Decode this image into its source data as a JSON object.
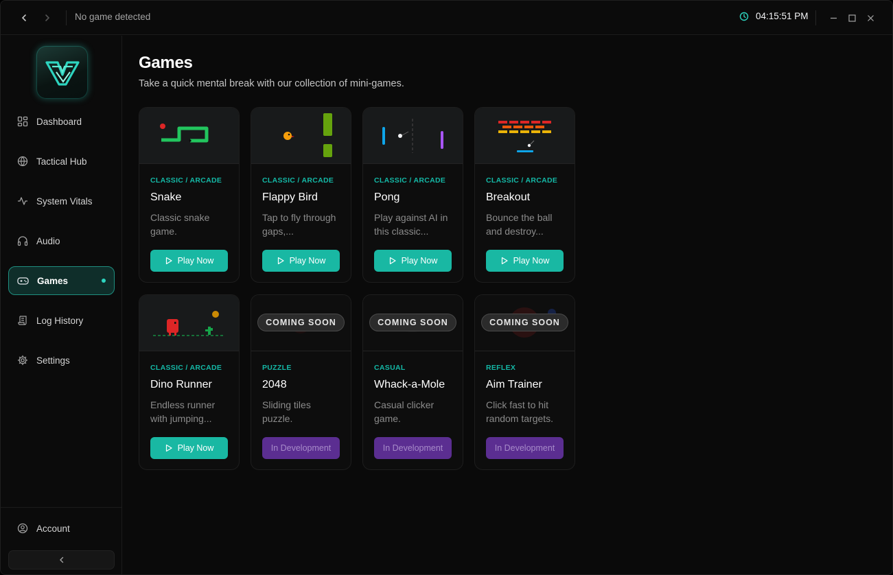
{
  "titlebar": {
    "status": "No game detected",
    "time": "04:15:51 PM"
  },
  "sidebar": {
    "items": [
      {
        "label": "Dashboard"
      },
      {
        "label": "Tactical Hub"
      },
      {
        "label": "System Vitals"
      },
      {
        "label": "Audio"
      },
      {
        "label": "Games"
      },
      {
        "label": "Log History"
      },
      {
        "label": "Settings"
      }
    ],
    "account": "Account",
    "active": "Games"
  },
  "main": {
    "title": "Games",
    "subtitle": "Take a quick mental break with our collection of mini-games."
  },
  "games": [
    {
      "category": "CLASSIC / ARCADE",
      "name": "Snake",
      "desc": "Classic snake game.",
      "action": "Play Now"
    },
    {
      "category": "CLASSIC / ARCADE",
      "name": "Flappy Bird",
      "desc": "Tap to fly through gaps,...",
      "action": "Play Now"
    },
    {
      "category": "CLASSIC / ARCADE",
      "name": "Pong",
      "desc": "Play against AI in this classic...",
      "action": "Play Now"
    },
    {
      "category": "CLASSIC / ARCADE",
      "name": "Breakout",
      "desc": "Bounce the ball and destroy...",
      "action": "Play Now"
    },
    {
      "category": "CLASSIC / ARCADE",
      "name": "Dino Runner",
      "desc": "Endless runner with jumping...",
      "action": "Play Now"
    },
    {
      "category": "PUZZLE",
      "name": "2048",
      "desc": "Sliding tiles puzzle.",
      "action": "In Development",
      "badge": "COMING SOON"
    },
    {
      "category": "CASUAL",
      "name": "Whack-a-Mole",
      "desc": "Casual clicker game.",
      "action": "In Development",
      "badge": "COMING SOON"
    },
    {
      "category": "REFLEX",
      "name": "Aim Trainer",
      "desc": "Click fast to hit random targets.",
      "action": "In Development",
      "badge": "COMING SOON"
    }
  ],
  "colors": {
    "accent": "#19b8a3",
    "category": "#14b8a6",
    "dev": "#5b2e91",
    "active_bg": "#0f2e2a"
  }
}
